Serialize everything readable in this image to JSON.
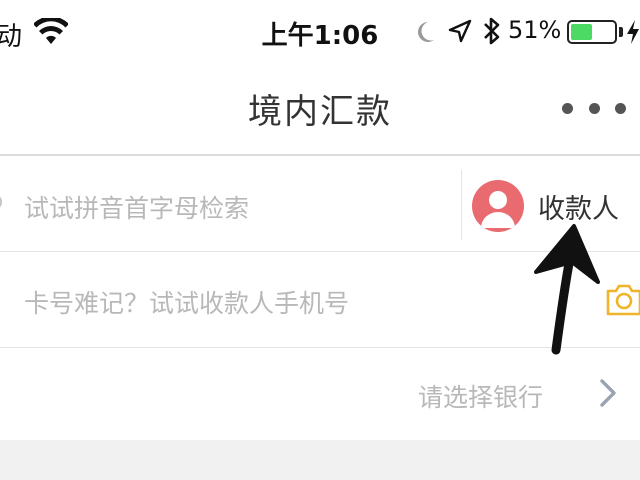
{
  "status_bar": {
    "carrier": "动",
    "time": "上午1:06",
    "battery_percent": "51%",
    "battery_level": 0.51,
    "battery_color": "#4cd964"
  },
  "nav": {
    "title": "境内汇款",
    "more_icon": "ellipsis-icon"
  },
  "form": {
    "search": {
      "placeholder": "试试拼音首字母检索",
      "payee_button_label": "收款人",
      "avatar_icon": "person-avatar-icon",
      "avatar_color": "#e96a6f"
    },
    "card": {
      "placeholder": "卡号难记？试试收款人手机号",
      "camera_icon": "camera-icon",
      "camera_color": "#f0b429"
    },
    "bank": {
      "value": "请选择银行",
      "chevron_icon": "chevron-right-icon"
    }
  },
  "annotation": {
    "arrow_icon": "arrow-up-annotation"
  }
}
